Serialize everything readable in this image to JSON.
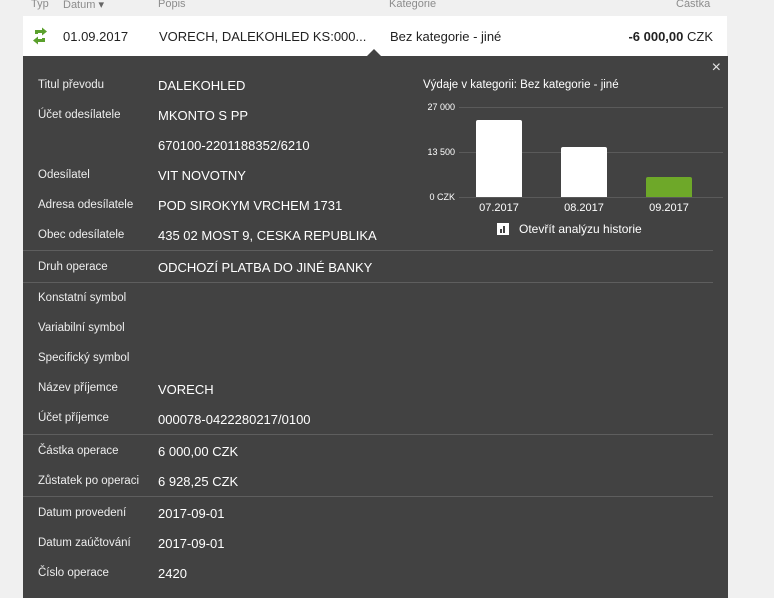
{
  "columns": {
    "type": "Typ",
    "date": "Datum",
    "sort_indicator": "▾",
    "description": "Popis",
    "category": "Kategorie",
    "amount": "Částka"
  },
  "transaction": {
    "type_icon": "transfer-arrows-icon",
    "date": "01.09.2017",
    "description": "VORECH, DALEKOHLED KS:000...",
    "category": "Bez kategorie - jiné",
    "amount": "-6 000,00",
    "currency": "CZK"
  },
  "detail": {
    "close": "×",
    "fields": [
      {
        "label": "Titul převodu",
        "value": "DALEKOHLED"
      },
      {
        "label": "Účet odesílatele",
        "value": "MKONTO S PP"
      },
      {
        "label": "",
        "value": "670100-2201188352/6210"
      },
      {
        "label": "Odesílatel",
        "value": "VIT NOVOTNY"
      },
      {
        "label": "Adresa odesílatele",
        "value": "POD SIROKYM VRCHEM 1731"
      },
      {
        "label": "Obec odesílatele",
        "value": "435 02 MOST 9, CESKA REPUBLIKA"
      },
      {
        "label": "Druh operace",
        "value": "ODCHOZÍ PLATBA DO JINÉ BANKY"
      },
      {
        "label": "Konstatní symbol",
        "value": ""
      },
      {
        "label": "Variabilní symbol",
        "value": ""
      },
      {
        "label": "Specifický symbol",
        "value": ""
      },
      {
        "label": "Název příjemce",
        "value": "VORECH"
      },
      {
        "label": "Účet příjemce",
        "value": "000078-0422280217/0100"
      },
      {
        "label": "Částka operace",
        "value": "6 000,00 CZK"
      },
      {
        "label": "Zůstatek po operaci",
        "value": "6 928,25 CZK"
      },
      {
        "label": "Datum provedení",
        "value": "2017-09-01"
      },
      {
        "label": "Datum zaúčtování",
        "value": "2017-09-01"
      },
      {
        "label": "Číslo operace",
        "value": "2420"
      }
    ],
    "history_link": "Otevřít analýzu historie"
  },
  "chart_data": {
    "type": "bar",
    "title": "Výdaje v kategorii:  Bez kategorie - jiné",
    "categories": [
      "07.2017",
      "08.2017",
      "09.2017"
    ],
    "values": [
      23000,
      15000,
      6000
    ],
    "bar_colors": [
      "#ffffff",
      "#ffffff",
      "#6ea829"
    ],
    "ylim": [
      0,
      27000
    ],
    "yticks": [
      {
        "value": 27000,
        "label": "27 000"
      },
      {
        "value": 13500,
        "label": "13 500"
      },
      {
        "value": 0,
        "label": "0 CZK"
      }
    ]
  },
  "colors": {
    "panel_bg": "#424242",
    "accent_green": "#6ea829",
    "page_bg": "#f0f0f0"
  }
}
